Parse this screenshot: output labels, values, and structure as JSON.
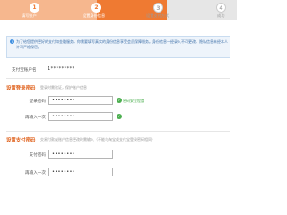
{
  "steps": [
    {
      "number": "1",
      "label": "填写账户"
    },
    {
      "number": "2",
      "label": "设置身份信息"
    },
    {
      "number": "3",
      "label": "设置支付方式"
    },
    {
      "number": "4",
      "label": "成功"
    }
  ],
  "notice": {
    "text": "为了给您提供更好的支付和金融服务，你需要填写真实的身份信息享受会员保障服务。身份信息一经录入不可更改，隐私信息未经本人许可严格保密。"
  },
  "account": {
    "label": "支付宝账户名",
    "value": "1*********"
  },
  "login_section": {
    "title": "设置登录密码",
    "hint": "登录时需验证，保护账户信息",
    "fields": [
      {
        "label": "登录密码",
        "value": "••••••••"
      },
      {
        "label": "再输入一次",
        "value": "••••••••"
      }
    ],
    "strength": "密码安全程度"
  },
  "pay_section": {
    "title": "设置支付密码",
    "hint": "交易付款或账户信息更改时需输入（不能与淘宝或支付宝登录密码相同）",
    "fields": [
      {
        "label": "支付密码",
        "value": "••••••••"
      },
      {
        "label": "再输入一次",
        "value": "••••••••"
      }
    ]
  },
  "colors": {
    "accent": "#ef7a32",
    "title": "#e06420",
    "ok": "#4caf50",
    "notice_bg": "#eef4fb"
  }
}
